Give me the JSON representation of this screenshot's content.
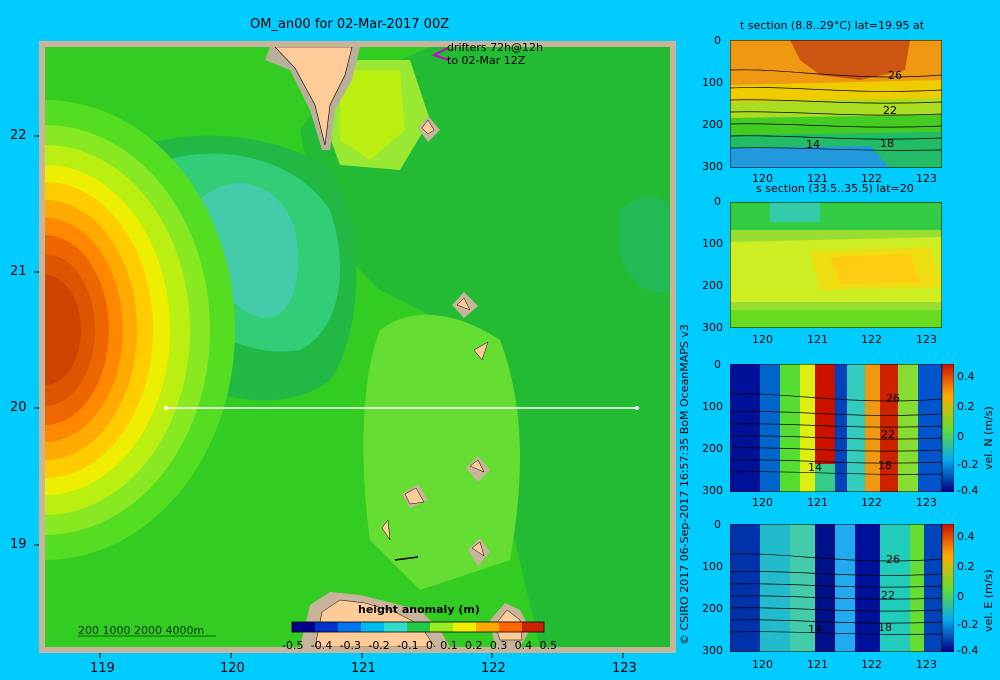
{
  "map": {
    "title": "OM_an00 for 02-Mar-2017 00Z",
    "drifter_label_1": "drifters 72h@12h",
    "drifter_label_2": "to 02-Mar 12Z",
    "depth_scale": "200  1000  2000  4000m",
    "x_ticks": [
      "119",
      "120",
      "121",
      "122",
      "123"
    ],
    "y_ticks": [
      "22",
      "21",
      "20",
      "19"
    ],
    "colorbar": {
      "label": "height anomaly (m)",
      "ticks": [
        "-0.5",
        "-0.4",
        "-0.3",
        "-0.2",
        "-0.1",
        "0",
        "0.1",
        "0.2",
        "0.3",
        "0.4",
        "0.5"
      ],
      "colors": [
        "#00008b",
        "#0033cc",
        "#0077ee",
        "#00bbee",
        "#33ddcc",
        "#22cc44",
        "#99ee22",
        "#eeee00",
        "#ffaa00",
        "#ff6600",
        "#cc2200"
      ]
    }
  },
  "credit": "© CSIRO 2017   06-Sep-2017 16:57:35 BoM OceanMAPS v3",
  "panels": [
    {
      "title": "t section (8.8..29°C) lat=19.95 at",
      "y_ticks": [
        "0",
        "100",
        "200",
        "300"
      ],
      "x_ticks": [
        "120",
        "121",
        "122",
        "123"
      ],
      "contour_labels": [
        "26",
        "22",
        "18",
        "14"
      ]
    },
    {
      "title": "s section (33.5..35.5) lat=20",
      "y_ticks": [
        "0",
        "100",
        "200",
        "300"
      ],
      "x_ticks": [
        "120",
        "121",
        "122",
        "123"
      ],
      "contour_labels": []
    },
    {
      "title": "",
      "y_ticks": [
        "0",
        "100",
        "200",
        "300"
      ],
      "x_ticks": [
        "120",
        "121",
        "122",
        "123"
      ],
      "contour_labels": [
        "26",
        "22",
        "18",
        "14"
      ],
      "colorbar_label": "vel. N (m/s)",
      "colorbar_ticks": [
        "0.4",
        "0.2",
        "0",
        "-0.2",
        "-0.4"
      ]
    },
    {
      "title": "",
      "y_ticks": [
        "0",
        "100",
        "200",
        "300"
      ],
      "x_ticks": [
        "120",
        "121",
        "122",
        "123"
      ],
      "contour_labels": [
        "26",
        "22",
        "18",
        "14"
      ],
      "colorbar_label": "vel. E (m/s)",
      "colorbar_ticks": [
        "0.4",
        "0.2",
        "0",
        "-0.2",
        "-0.4"
      ]
    }
  ]
}
